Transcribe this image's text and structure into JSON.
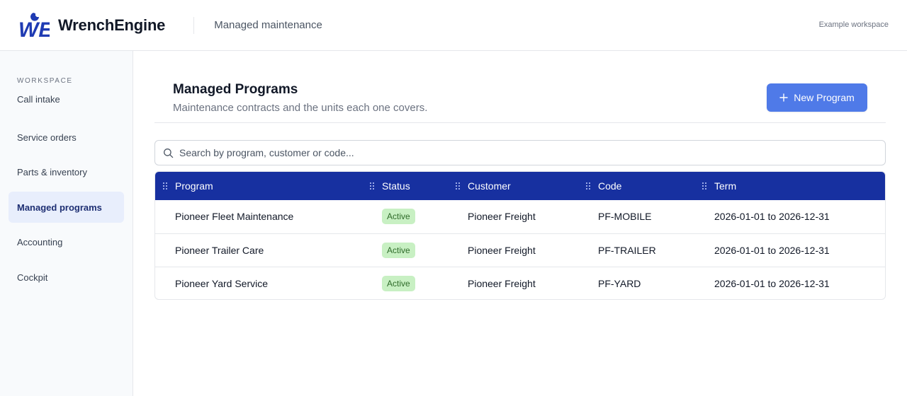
{
  "header": {
    "brand_name": "WrenchEngine",
    "section": "Managed maintenance",
    "workspace": "Example workspace"
  },
  "sidebar": {
    "heading": "WORKSPACE",
    "items": [
      {
        "label": "Call intake"
      },
      {
        "label": "Service orders"
      },
      {
        "label": "Parts & inventory"
      },
      {
        "label": "Managed programs",
        "active": true
      },
      {
        "label": "Accounting"
      },
      {
        "label": "Cockpit"
      }
    ]
  },
  "page": {
    "title": "Managed Programs",
    "subtitle": "Maintenance contracts and the units each one covers.",
    "new_button_label": "New Program"
  },
  "search": {
    "placeholder": "Search by program, customer or code...",
    "value": ""
  },
  "table": {
    "columns": [
      "Program",
      "Status",
      "Customer",
      "Code",
      "Term"
    ],
    "rows": [
      {
        "program": "Pioneer Fleet Maintenance",
        "status": "Active",
        "customer": "Pioneer Freight",
        "code": "PF-MOBILE",
        "term": "2026-01-01 to 2026-12-31"
      },
      {
        "program": "Pioneer Trailer Care",
        "status": "Active",
        "customer": "Pioneer Freight",
        "code": "PF-TRAILER",
        "term": "2026-01-01 to 2026-12-31"
      },
      {
        "program": "Pioneer Yard Service",
        "status": "Active",
        "customer": "Pioneer Freight",
        "code": "PF-YARD",
        "term": "2026-01-01 to 2026-12-31"
      }
    ]
  },
  "colors": {
    "brand": "#1f3bb3",
    "primary_button": "#4f7ae8",
    "table_header": "#1730a0",
    "active_nav_bg": "#e8eefc",
    "status_active_bg": "#c8f0c3"
  },
  "icons": {
    "logo": "wrench-engine-logo",
    "new_button": "plus-icon",
    "search": "search-icon",
    "column_handle": "drag-handle-icon"
  }
}
